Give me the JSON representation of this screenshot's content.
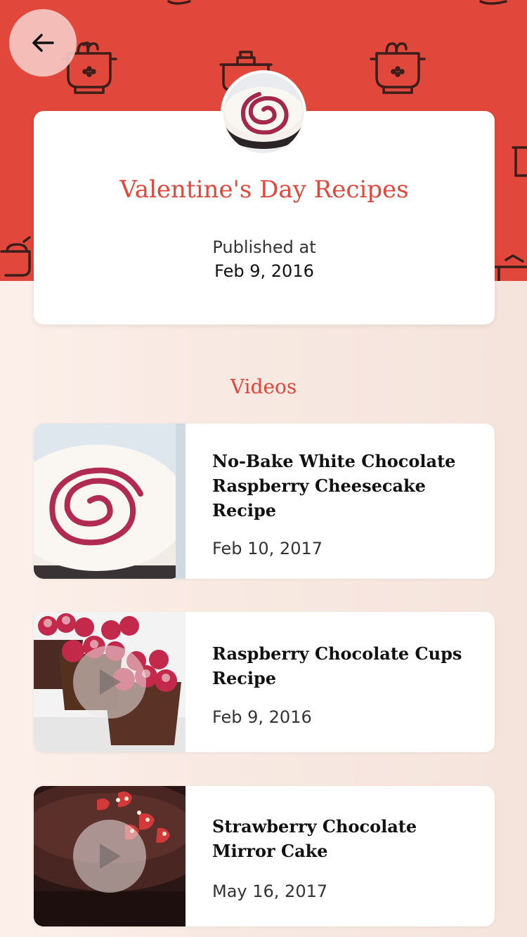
{
  "header": {
    "back_label": "Back",
    "title": "Valentine's Day Recipes",
    "published_label": "Published at",
    "published_date": "Feb 9, 2016",
    "accent_color": "#e1473a"
  },
  "videos_section": {
    "title": "Videos",
    "items": [
      {
        "title": "No-Bake White Chocolate Raspberry Cheesecake Recipe",
        "date": "Feb 10, 2017",
        "thumbnail": "raspberry-cheesecake"
      },
      {
        "title": "Raspberry Chocolate Cups Recipe",
        "date": "Feb 9, 2016",
        "thumbnail": "raspberry-chocolate-cups"
      },
      {
        "title": "Strawberry Chocolate Mirror Cake",
        "date": "May 16, 2017",
        "thumbnail": "strawberry-mirror-cake"
      }
    ]
  },
  "icons": {
    "back": "arrow-left-icon",
    "play": "play-icon",
    "pattern": "cooking-pot-icon"
  }
}
